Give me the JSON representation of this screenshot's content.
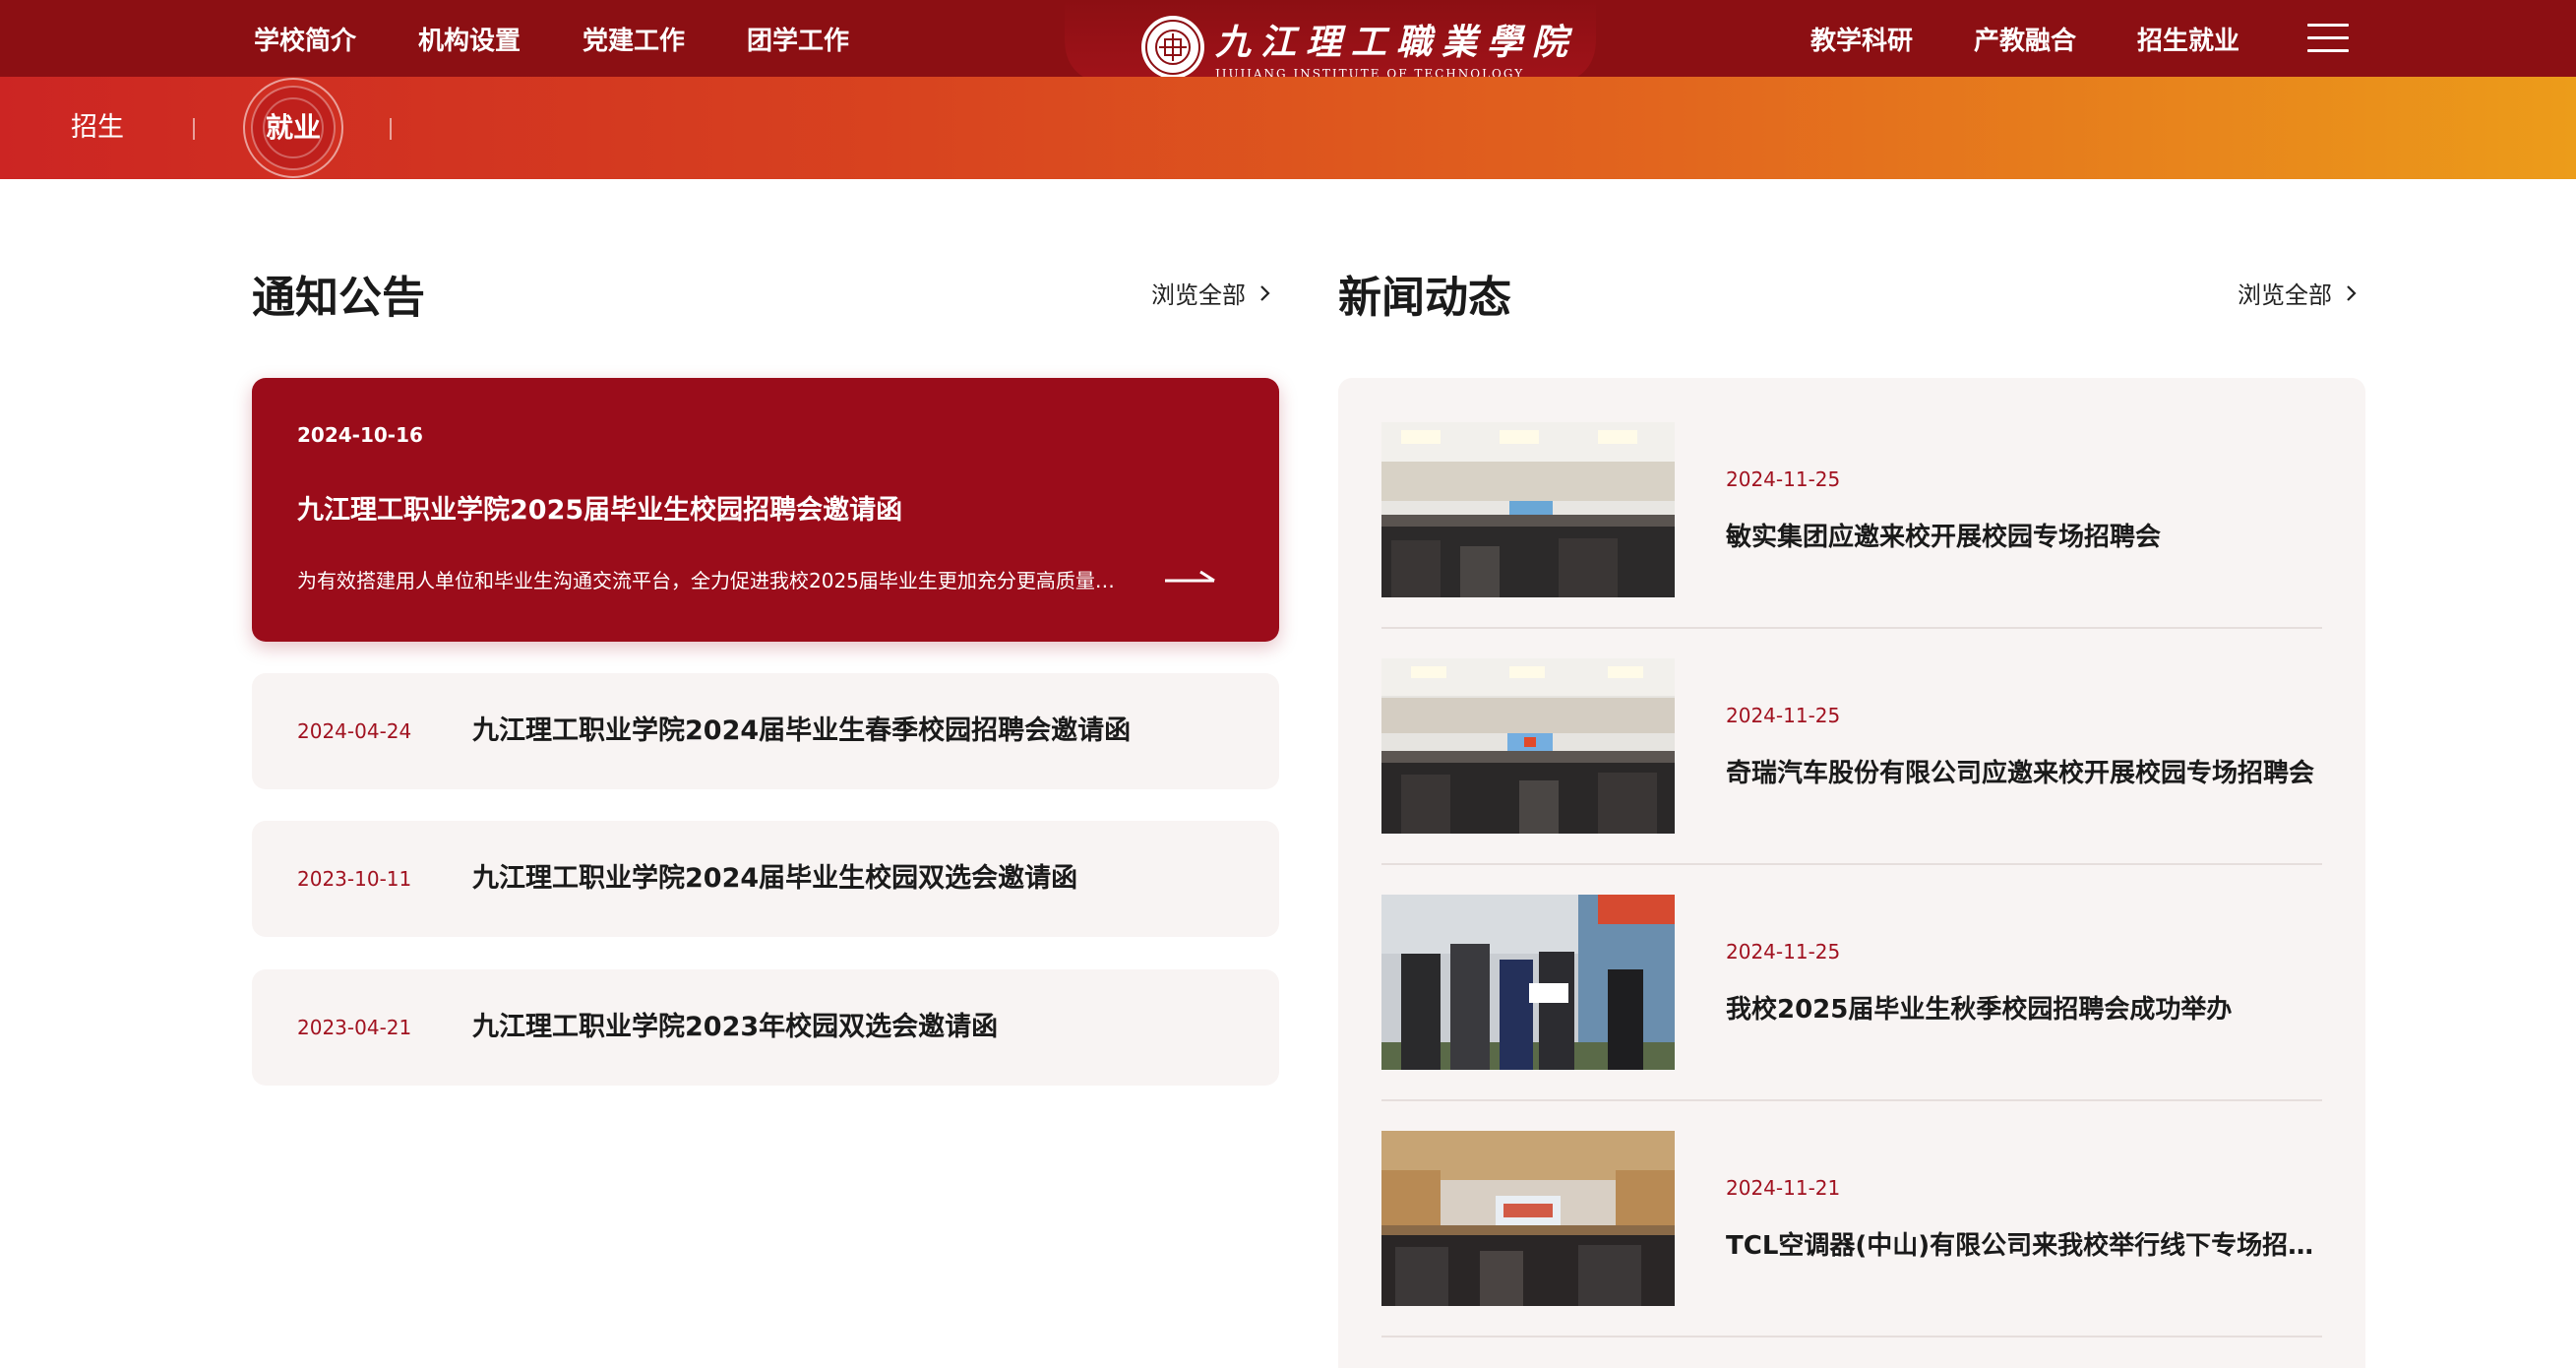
{
  "nav": {
    "left": [
      "学校简介",
      "机构设置",
      "党建工作",
      "团学工作"
    ],
    "right": [
      "教学科研",
      "产教融合",
      "招生就业"
    ]
  },
  "logo": {
    "name_cn": "九江理工職業學院",
    "name_en": "JIUJIANG INSTITUTE OF TECHNOLOGY"
  },
  "subnav": {
    "items": [
      "招生",
      "就业"
    ],
    "active": "就业"
  },
  "notices": {
    "title": "通知公告",
    "view_all": "浏览全部",
    "featured": {
      "date": "2024-10-16",
      "title": "九江理工职业学院2025届毕业生校园招聘会邀请函",
      "desc": "为有效搭建用人单位和毕业生沟通交流平台，全力促进我校2025届毕业生更加充分更高质量就..."
    },
    "items": [
      {
        "date": "2024-04-24",
        "title": "九江理工职业学院2024届毕业生春季校园招聘会邀请函"
      },
      {
        "date": "2023-10-11",
        "title": "九江理工职业学院2024届毕业生校园双选会邀请函"
      },
      {
        "date": "2023-04-21",
        "title": "九江理工职业学院2023年校园双选会邀请函"
      }
    ]
  },
  "news": {
    "title": "新闻动态",
    "view_all": "浏览全部",
    "items": [
      {
        "date": "2024-11-25",
        "title": "敏实集团应邀来校开展校园专场招聘会"
      },
      {
        "date": "2024-11-25",
        "title": "奇瑞汽车股份有限公司应邀来校开展校园专场招聘会"
      },
      {
        "date": "2024-11-25",
        "title": "我校2025届毕业生秋季校园招聘会成功举办"
      },
      {
        "date": "2024-11-21",
        "title": "TCL空调器(中山)有限公司来我校举行线下专场招..."
      }
    ]
  },
  "colors": {
    "primary": "#8c0f13",
    "featured_card": "#9b0c1a",
    "date_red": "#a11220",
    "card_bg": "#f8f4f3",
    "gradient_start": "#cc2523",
    "gradient_end": "#ec9c1a"
  },
  "icons": {
    "menu": "hamburger-icon",
    "chevron": "chevron-right-icon",
    "arrow": "arrow-right-icon",
    "seal": "school-seal-icon"
  }
}
